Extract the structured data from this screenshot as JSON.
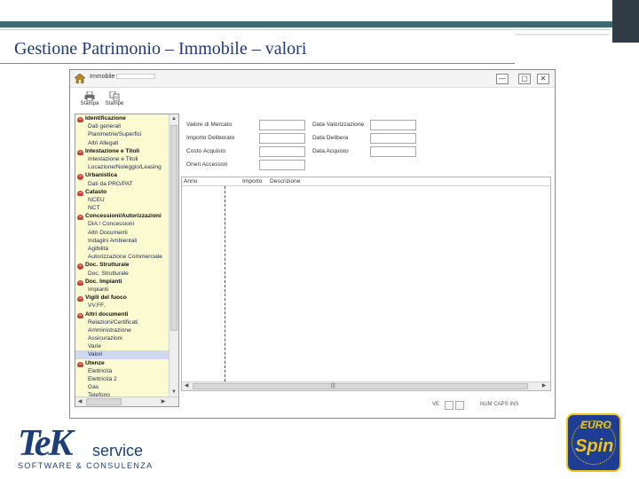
{
  "slide": {
    "title": "Gestione Patrimonio – Immobile – valori"
  },
  "window": {
    "title": "Immobile",
    "controls": {
      "minimize": "—",
      "maximize": "▢",
      "close": "✕"
    }
  },
  "toolbar": {
    "buttons": [
      {
        "label": "Stampa",
        "icon": "printer-icon"
      },
      {
        "label": "Stampe",
        "icon": "report-icon"
      }
    ]
  },
  "tree": {
    "nodes": [
      {
        "type": "group",
        "label": "Identificazione"
      },
      {
        "type": "child",
        "label": "Dati generali"
      },
      {
        "type": "child",
        "label": "Planimetrie/Superfici"
      },
      {
        "type": "child",
        "label": "Altri Allegati"
      },
      {
        "type": "group",
        "label": "Intestazione e Titoli"
      },
      {
        "type": "child",
        "label": "Intestazione e Titoli"
      },
      {
        "type": "child",
        "label": "Locazione/Noleggio/Leasing"
      },
      {
        "type": "group",
        "label": "Urbanistica"
      },
      {
        "type": "child",
        "label": "Dati da PRG/PAT"
      },
      {
        "type": "group",
        "label": "Catasto"
      },
      {
        "type": "child",
        "label": "NCEU"
      },
      {
        "type": "child",
        "label": "NCT"
      },
      {
        "type": "group",
        "label": "Concessioni/Autorizzazioni"
      },
      {
        "type": "child",
        "label": "DIA / Concessioni"
      },
      {
        "type": "child",
        "label": "Altri Documenti"
      },
      {
        "type": "child",
        "label": "Indagini Ambientali"
      },
      {
        "type": "child",
        "label": "Agibilità"
      },
      {
        "type": "child",
        "label": "Autorizzazione Commerciale"
      },
      {
        "type": "group",
        "label": "Doc. Strutturale"
      },
      {
        "type": "child",
        "label": "Doc. Strutturale"
      },
      {
        "type": "group",
        "label": "Doc. Impianti"
      },
      {
        "type": "child",
        "label": "Impianti"
      },
      {
        "type": "group",
        "label": "Vigili del fuoco"
      },
      {
        "type": "child",
        "label": "VV.FF."
      },
      {
        "type": "group",
        "label": "Altri documenti"
      },
      {
        "type": "child",
        "label": "Relazioni/Certificati"
      },
      {
        "type": "child",
        "label": "Amministrazione"
      },
      {
        "type": "child",
        "label": "Assicurazioni"
      },
      {
        "type": "child",
        "label": "Varie"
      },
      {
        "type": "child",
        "label": "Valori",
        "selected": true
      },
      {
        "type": "group",
        "label": "Utenze"
      },
      {
        "type": "child",
        "label": "Elettricità"
      },
      {
        "type": "child",
        "label": "Elettricità 2"
      },
      {
        "type": "child",
        "label": "Gas"
      },
      {
        "type": "child",
        "label": "Telefono"
      }
    ]
  },
  "form": {
    "left": [
      {
        "label": "Valore di Mercato",
        "value": ""
      },
      {
        "label": "Importo Deliberato",
        "value": ""
      },
      {
        "label": "Costo Acquisto",
        "value": ""
      },
      {
        "label": "Oneri Accessori",
        "value": ""
      }
    ],
    "right": [
      {
        "label": "Data Valorizzazione",
        "value": ""
      },
      {
        "label": "Data Delibera",
        "value": ""
      },
      {
        "label": "Data Acquisto",
        "value": ""
      }
    ]
  },
  "grid": {
    "columns": [
      "Anno",
      "Importo",
      "Descrizione"
    ]
  },
  "statusbar": {
    "left": "VE",
    "right": "NUM CAPS INS"
  },
  "logos": {
    "tek_main": "TeK",
    "tek_service": "service",
    "tek_sub": "SOFTWARE & CONSULENZA",
    "euro_top": "EURO",
    "euro_bottom": "Spin"
  },
  "colors": {
    "tree_bg": "#fbfbd2",
    "group_icon": "#c64040",
    "title_text": "#1f3a7a",
    "brand_blue": "#1d3e93",
    "brand_yellow": "#f1c515"
  }
}
